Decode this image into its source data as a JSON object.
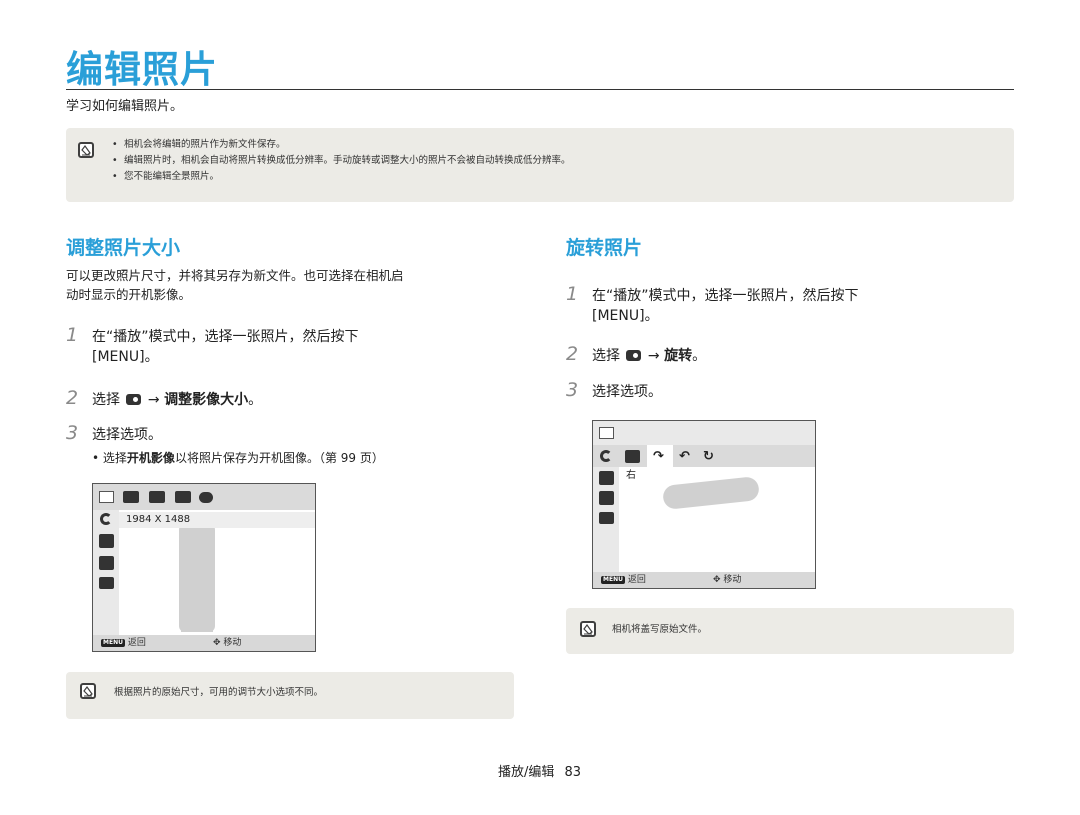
{
  "page": {
    "title": "编辑照片",
    "subtitle": "学习如何编辑照片。",
    "top_note": [
      "相机会将编辑的照片作为新文件保存。",
      "编辑照片时，相机会自动将照片转换成低分辨率。手动旋转或调整大小的照片不会被自动转换成低分辨率。",
      "您不能编辑全景照片。"
    ],
    "footer": {
      "section": "播放/编辑",
      "page_number": "83"
    }
  },
  "resize": {
    "heading": "调整照片大小",
    "intro": [
      "可以更改照片尺寸，并将其另存为新文件。也可选择在相机启",
      "动时显示的开机影像。"
    ],
    "step1": {
      "num": "1",
      "line1": "在“播放”模式中，选择一张照片，然后按下",
      "line2": "[MENU]。"
    },
    "step2": {
      "num": "2",
      "pre": "选择",
      "arrow": "→",
      "target": "调整影像大小",
      "post": "。"
    },
    "step3": {
      "num": "3",
      "text": "选择选项。"
    },
    "bullet": {
      "pre": "选择",
      "bold": "开机影像",
      "post": "以将照片保存为开机图像。（第 99 页）"
    },
    "screen": {
      "top_icons": [
        "resize-icon",
        "5m-icon",
        "3m-icon",
        "1m-icon",
        "start-image-icon"
      ],
      "left_icons": [
        "rotate-icon",
        "photo-style-off-icon",
        "smart-filter-off-icon",
        "face-retouch-icon"
      ],
      "size_label": "1984 X 1488",
      "back_chip": "MENU",
      "back_label": "返回",
      "move_label": "移动"
    },
    "note": "根据照片的原始尺寸，可用的调节大小选项不同。"
  },
  "rotate": {
    "heading": "旋转照片",
    "step1": {
      "num": "1",
      "line1": "在“播放”模式中，选择一张照片，然后按下",
      "line2": "[MENU]。"
    },
    "step2": {
      "num": "2",
      "pre": "选择",
      "arrow": "→",
      "target": "旋转",
      "post": "。"
    },
    "step3": {
      "num": "3",
      "text": "选择选项。"
    },
    "screen": {
      "top_icons": [
        "resize-icon"
      ],
      "row_icons": [
        "rotate-icon",
        "rotate-off-icon",
        "rotate-right-icon",
        "rotate-left-icon",
        "rotate-180-icon"
      ],
      "left_icons": [
        "photo-style-off-icon",
        "smart-filter-off-icon",
        "face-retouch-icon"
      ],
      "selected_label": "右",
      "back_chip": "MENU",
      "back_label": "返回",
      "move_label": "移动"
    },
    "note": "相机将盖写原始文件。"
  },
  "colors": {
    "accent": "#2a9fd8",
    "note_bg": "#ecebe6",
    "step_num": "#8a8a8a"
  }
}
